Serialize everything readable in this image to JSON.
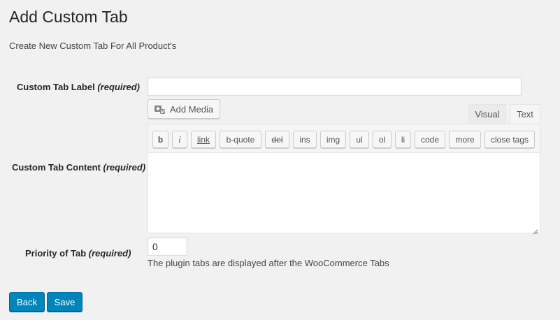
{
  "header": {
    "title": "Add Custom Tab",
    "description": "Create New Custom Tab For All Product's"
  },
  "fields": {
    "tab_label": {
      "label": "Custom Tab Label",
      "required": "(required)",
      "value": ""
    },
    "tab_content": {
      "label": "Custom Tab Content",
      "required": "(required)",
      "value": ""
    },
    "priority": {
      "label": "Priority of Tab",
      "required": "(required)",
      "value": "0",
      "hint": "The plugin tabs are displayed after the WooCommerce Tabs"
    }
  },
  "editor": {
    "add_media_label": "Add Media",
    "add_media_icon": "media-icon",
    "tabs": {
      "visual": "Visual",
      "text": "Text"
    },
    "quicktags": [
      "b",
      "i",
      "link",
      "b-quote",
      "del",
      "ins",
      "img",
      "ul",
      "ol",
      "li",
      "code",
      "more",
      "close tags"
    ]
  },
  "actions": {
    "back_label": "Back",
    "save_label": "Save"
  },
  "colors": {
    "background": "#f1f1f1",
    "primary_button": "#0085ba",
    "primary_border": "#0073aa"
  }
}
